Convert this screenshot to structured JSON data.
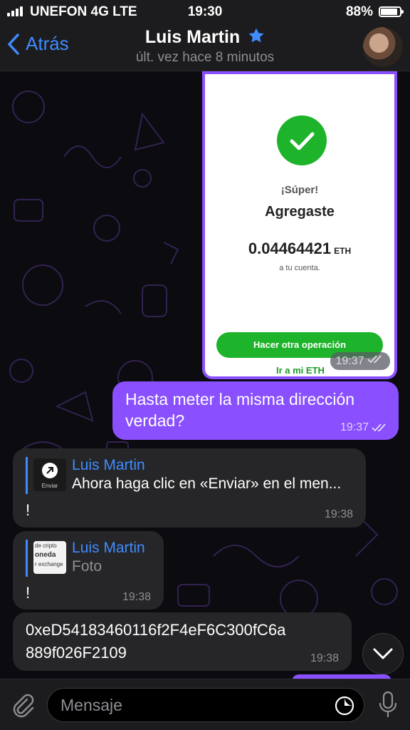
{
  "status_bar": {
    "carrier": "UNEFON 4G  LTE",
    "time": "19:30",
    "battery_pct": "88%",
    "battery_level": 0.88
  },
  "header": {
    "back_label": "Atrás",
    "contact_name": "Luis Martin",
    "last_seen": "últ. vez hace 8 minutos"
  },
  "messages": {
    "receipt_image": {
      "super": "¡Súper!",
      "title": "Agregaste",
      "amount": "0.04464421",
      "unit": "ETH",
      "note": "a tu cuenta.",
      "button": "Hacer otra operación",
      "link": "Ir a mi ETH",
      "time": "19:37"
    },
    "outgoing_1": {
      "text": "Hasta meter la misma dirección verdad?",
      "time": "19:37"
    },
    "incoming_1": {
      "reply_name": "Luis Martin",
      "reply_text": "Ahora haga clic en «Enviar» en el men...",
      "thumb_label": "Enviar",
      "body": "!",
      "time": "19:38"
    },
    "incoming_2": {
      "reply_name": "Luis Martin",
      "reply_text": "Foto",
      "thumb_lines": [
        "de cripto",
        "oneda",
        "r exchange"
      ],
      "body": "!",
      "time": "19:38"
    },
    "incoming_3": {
      "text_line1": "0xeD54183460116f2F4eF6C300fC6a",
      "text_line2": "889f026F2109",
      "time": "19:38"
    }
  },
  "input": {
    "placeholder": "Mensaje"
  },
  "colors": {
    "accent": "#3f8cff",
    "outgoing_bubble": "#8a4fff",
    "incoming_bubble": "#262628",
    "success_green": "#1db32a"
  }
}
